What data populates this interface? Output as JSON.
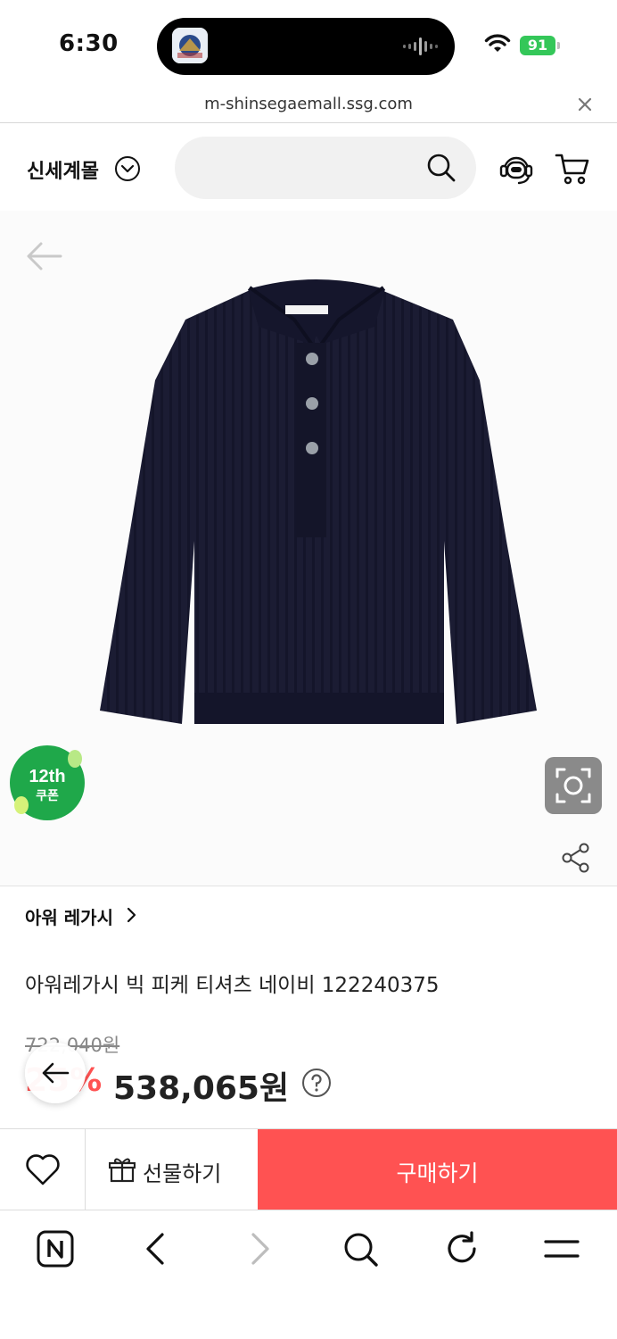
{
  "status_bar": {
    "time": "6:30",
    "battery": "91"
  },
  "url_bar": {
    "url": "m-shinsegaemall.ssg.com"
  },
  "header": {
    "logo": "신세계몰",
    "search_placeholder": ""
  },
  "product": {
    "coupon_line1": "12th",
    "coupon_line2": "쿠폰",
    "brand": "아워 레가시",
    "title": "아워레가시 빅 피케 티셔츠 네이비 122240375",
    "original_price": "722,040원",
    "discount": "25%",
    "price": "538,065원"
  },
  "actions": {
    "gift_label": "선물하기",
    "buy_label": "구매하기"
  },
  "colors": {
    "accent": "#ff5252",
    "coupon_green": "#1fa84a",
    "battery": "#34c759"
  },
  "icons": {
    "status": [
      "wifi-icon",
      "battery-icon"
    ],
    "header": [
      "chevron-down-icon",
      "search-icon",
      "chatbot-icon",
      "cart-icon"
    ],
    "product": [
      "back-arrow-icon",
      "camera-icon",
      "share-icon",
      "help-icon"
    ],
    "actions": [
      "heart-icon",
      "gift-icon"
    ],
    "toolbar": [
      "naver-icon",
      "back-icon",
      "forward-icon",
      "search-icon",
      "refresh-icon",
      "menu-icon"
    ]
  }
}
